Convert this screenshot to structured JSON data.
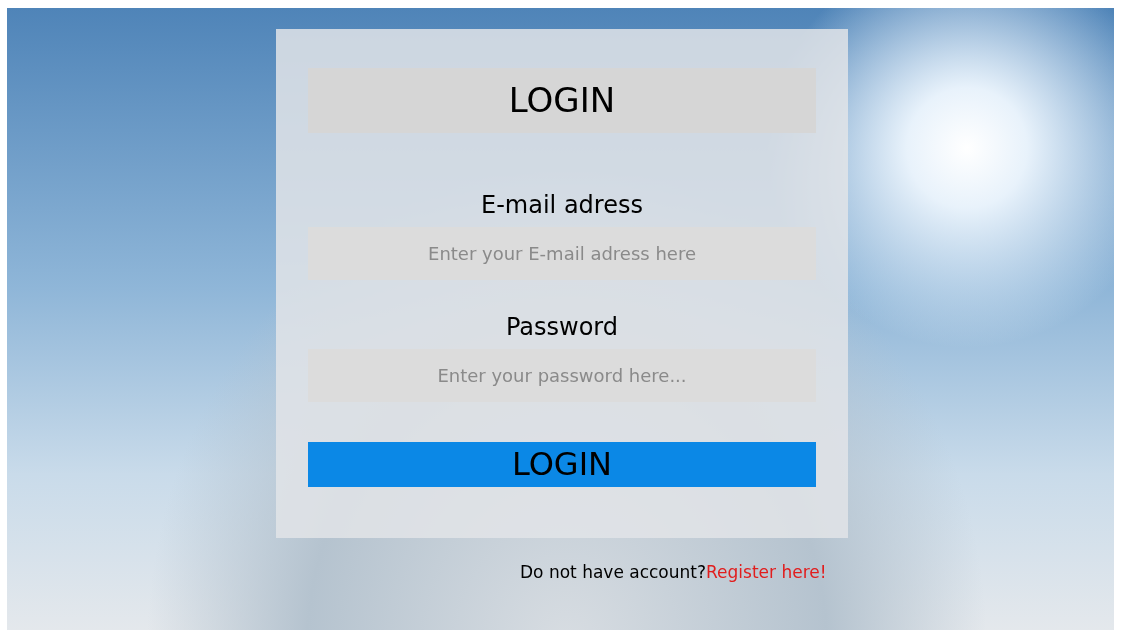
{
  "header": {
    "title": "LOGIN"
  },
  "fields": [
    {
      "label": "E-mail adress",
      "placeholder": "Enter your E-mail adress here"
    },
    {
      "label": "Password",
      "placeholder": "Enter your password here..."
    }
  ],
  "submit": {
    "label": "LOGIN"
  },
  "footer": {
    "text": "Do not have account?",
    "link": "Register here!"
  }
}
